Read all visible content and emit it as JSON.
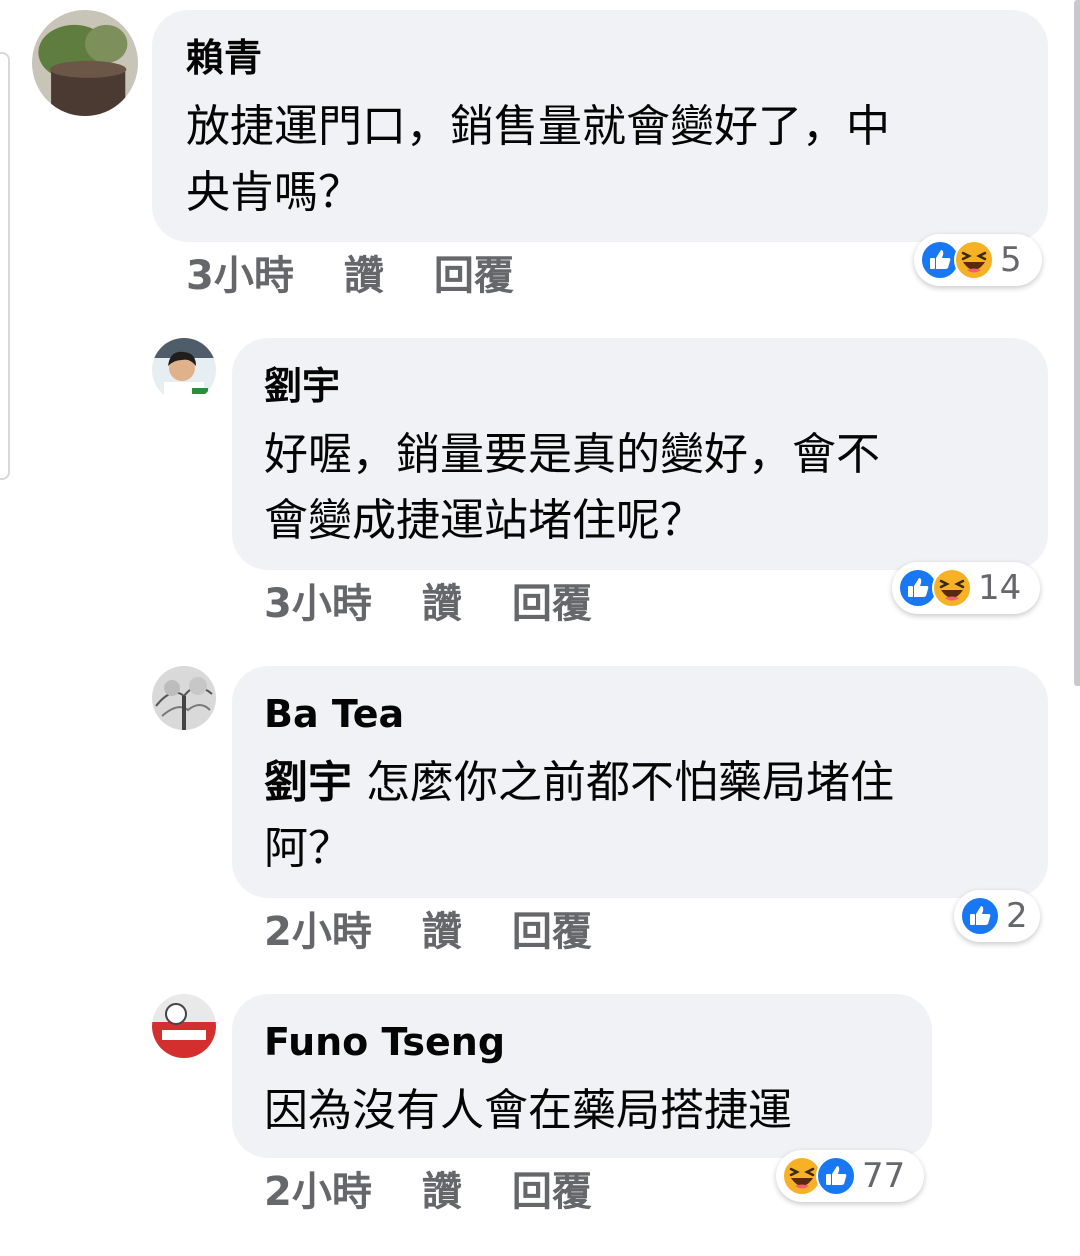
{
  "comments": [
    {
      "author": "賴青",
      "text_lines": [
        "放捷運門口，銷售量就會變好了，中",
        "央肯嗎？"
      ],
      "time": "3小時",
      "like_label": "讚",
      "reply_label": "回覆",
      "reactions": [
        "like-icon",
        "haha-icon"
      ],
      "reaction_count": "5"
    },
    {
      "author": "劉宇",
      "text_lines": [
        "好喔，銷量要是真的變好，會不",
        "會變成捷運站堵住呢？"
      ],
      "time": "3小時",
      "like_label": "讚",
      "reply_label": "回覆",
      "reactions": [
        "like-icon",
        "haha-icon"
      ],
      "reaction_count": "14"
    },
    {
      "author": "Ba Tea",
      "mention": "劉宇",
      "text_lines": [
        "怎麼你之前都不怕藥局堵住",
        "阿？"
      ],
      "time": "2小時",
      "like_label": "讚",
      "reply_label": "回覆",
      "reactions": [
        "like-icon"
      ],
      "reaction_count": "2"
    },
    {
      "author": "Funo Tseng",
      "text_lines": [
        "因為沒有人會在藥局搭捷運"
      ],
      "time": "2小時",
      "like_label": "讚",
      "reply_label": "回覆",
      "reactions": [
        "haha-icon",
        "like-icon"
      ],
      "reaction_count": "77"
    }
  ],
  "colors": {
    "bubble": "#f0f2f5",
    "meta_text": "#65676b",
    "like_blue": "#1877f2",
    "haha_yellow": "#f7b125"
  }
}
